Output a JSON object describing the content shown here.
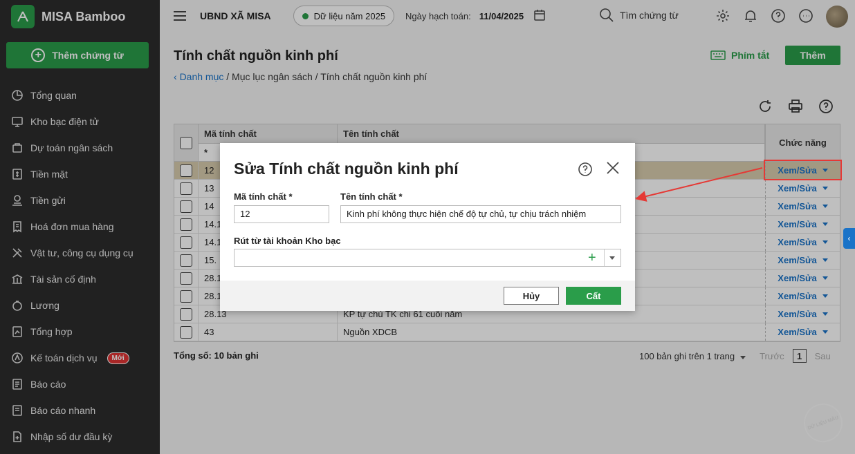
{
  "brand": {
    "name": "MISA Bamboo"
  },
  "sidebar": {
    "add_label": "Thêm chứng từ",
    "items": [
      {
        "label": "Tổng quan",
        "icon": "pie-chart-icon"
      },
      {
        "label": "Kho bạc điện tử",
        "icon": "monitor-icon"
      },
      {
        "label": "Dự toán ngân sách",
        "icon": "budget-icon"
      },
      {
        "label": "Tiền mặt",
        "icon": "cash-icon"
      },
      {
        "label": "Tiền gửi",
        "icon": "deposit-icon"
      },
      {
        "label": "Hoá đơn mua hàng",
        "icon": "invoice-icon"
      },
      {
        "label": "Vật tư, công cụ dụng cụ",
        "icon": "tools-icon"
      },
      {
        "label": "Tài sản cố định",
        "icon": "building-icon"
      },
      {
        "label": "Lương",
        "icon": "salary-icon"
      },
      {
        "label": "Tổng hợp",
        "icon": "summary-icon"
      },
      {
        "label": "Kế toán dịch vụ",
        "icon": "service-icon",
        "badge": "Mới"
      },
      {
        "label": "Báo cáo",
        "icon": "report-icon"
      },
      {
        "label": "Báo cáo nhanh",
        "icon": "quick-report-icon"
      },
      {
        "label": "Nhập số dư đầu kỳ",
        "icon": "opening-balance-icon"
      }
    ]
  },
  "topbar": {
    "org": "UBND XÃ MISA",
    "year": "Dữ liệu năm 2025",
    "posting_label": "Ngày hạch toán:",
    "posting_date": "11/04/2025",
    "search": "Tìm chứng từ"
  },
  "page": {
    "title": "Tính chất nguồn kinh phí",
    "shortcut": "Phím tắt",
    "add": "Thêm",
    "breadcrumb_link": "Danh mục",
    "breadcrumb_rest": " / Mục lục ngân sách / Tính chất nguồn kinh phí"
  },
  "table": {
    "col_code": "Mã tính chất",
    "col_name": "Tên tính chất",
    "col_func": "Chức năng",
    "filter_code": "*",
    "action": "Xem/Sửa",
    "rows": [
      {
        "code": "12",
        "name": ""
      },
      {
        "code": "13",
        "name": ""
      },
      {
        "code": "14",
        "name": ""
      },
      {
        "code": "14.1",
        "name": ""
      },
      {
        "code": "14.1",
        "name": ""
      },
      {
        "code": "15.",
        "name": ""
      },
      {
        "code": "28.1",
        "name": ""
      },
      {
        "code": "28.1",
        "name": ""
      },
      {
        "code": "28.13",
        "name": "KP tự chủ TK chi 61 cuối năm"
      },
      {
        "code": "43",
        "name": "Nguồn XDCB"
      }
    ]
  },
  "footer": {
    "total": "Tổng số: 10 bản ghi",
    "per_page": "100 bản ghi trên 1 trang",
    "prev": "Trước",
    "page": "1",
    "next": "Sau"
  },
  "dialog": {
    "title": "Sửa Tính chất nguồn kinh phí",
    "code_label": "Mã tính chất *",
    "code_value": "12",
    "name_label": "Tên tính chất *",
    "name_value": "Kinh phí không thực hiện chế độ tự chủ, tự chịu trách nhiệm",
    "account_label": "Rút từ tài khoản Kho bạc",
    "account_value": "",
    "cancel": "Hủy",
    "save": "Cất"
  },
  "watermark": "DỮ LIỆU MẪU",
  "colors": {
    "brand_green": "#2a9d4a",
    "link_blue": "#1a73c8",
    "highlight_red": "#e53935",
    "sidebar_bg": "#2d2d2d"
  }
}
